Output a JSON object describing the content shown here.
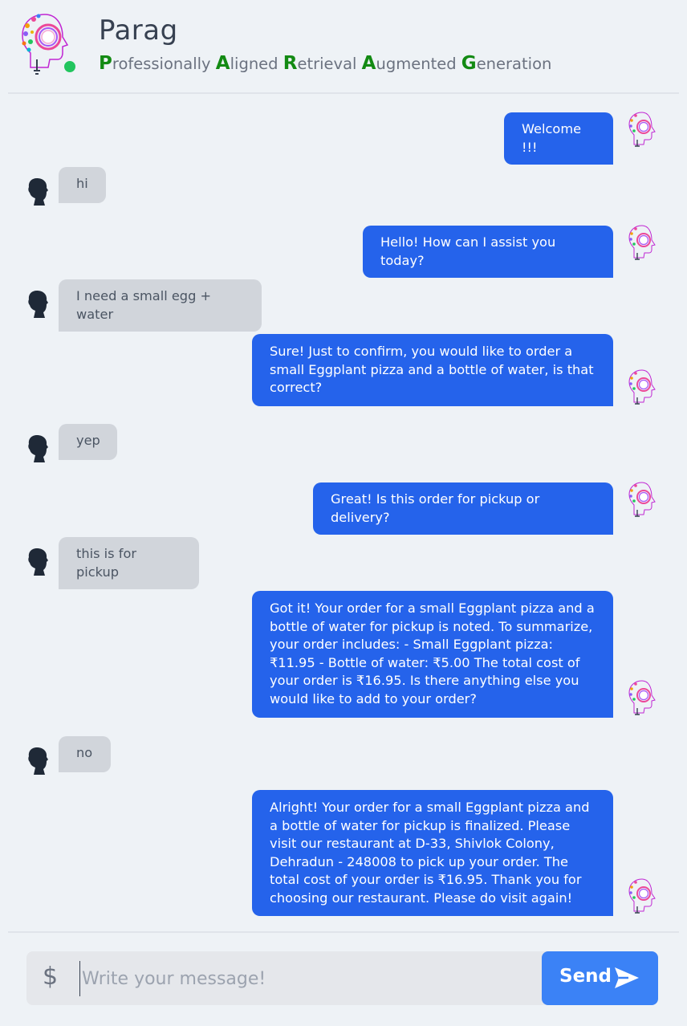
{
  "header": {
    "title": "Parag",
    "subtitle_parts": [
      {
        "cap": "P",
        "rest": "rofessionally "
      },
      {
        "cap": "A",
        "rest": "ligned "
      },
      {
        "cap": "R",
        "rest": "etrieval "
      },
      {
        "cap": "A",
        "rest": "ugmented "
      },
      {
        "cap": "G",
        "rest": "eneration"
      }
    ],
    "status": "online",
    "status_color": "#22c55e"
  },
  "colors": {
    "bot_bubble": "#2563eb",
    "user_bubble": "#d1d5db",
    "send_button": "#3b82f6",
    "acronym_caps": "#138a13"
  },
  "messages": [
    {
      "sender": "bot",
      "text": "Welcome !!!"
    },
    {
      "sender": "user",
      "text": "hi"
    },
    {
      "sender": "bot",
      "text": "Hello! How can I assist you today?"
    },
    {
      "sender": "user",
      "text": "I need a small egg + water"
    },
    {
      "sender": "bot",
      "text": "Sure! Just to confirm, you would like to order a small Eggplant pizza and a bottle of water, is that correct?"
    },
    {
      "sender": "user",
      "text": "yep"
    },
    {
      "sender": "bot",
      "text": "Great! Is this order for pickup or delivery?"
    },
    {
      "sender": "user",
      "text": "this is for pickup"
    },
    {
      "sender": "bot",
      "text": "Got it! Your order for a small Eggplant pizza and a bottle of water for pickup is noted. To summarize, your order includes: - Small Eggplant pizza: ₹11.95 - Bottle of water: ₹5.00 The total cost of your order is ₹16.95. Is there anything else you would like to add to your order?"
    },
    {
      "sender": "user",
      "text": "no"
    },
    {
      "sender": "bot",
      "text": "Alright! Your order for a small Eggplant pizza and a bottle of water for pickup is finalized. Please visit our restaurant at D-33, Shivlok Colony, Dehradun - 248008 to pick up your order. The total cost of your order is ₹16.95. Thank you for choosing our restaurant. Please do visit again!"
    }
  ],
  "composer": {
    "prefix_icon": "dollar-icon",
    "prefix_glyph": "$",
    "placeholder": "Write your message!",
    "value": "",
    "send_label": "Send",
    "send_icon": "paper-plane-icon"
  }
}
